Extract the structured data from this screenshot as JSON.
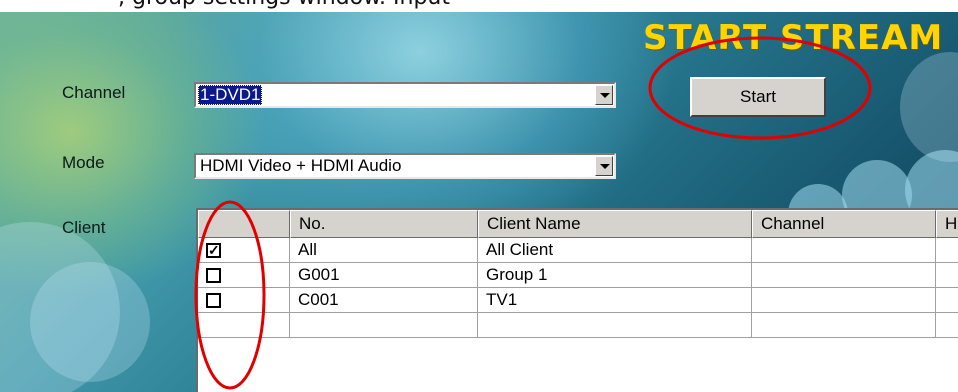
{
  "title": "START STREAM",
  "top_caption": ", group settings window. Input",
  "labels": {
    "channel": "Channel",
    "mode": "Mode",
    "client": "Client"
  },
  "channel_select": {
    "value": "1-DVD1"
  },
  "mode_select": {
    "value": "HDMI Video + HDMI Audio"
  },
  "start_button": {
    "label": "Start"
  },
  "table": {
    "columns": [
      "",
      "No.",
      "Client Name",
      "Channel",
      "H"
    ],
    "rows": [
      {
        "checked": true,
        "no": "All",
        "client_name": "All Client",
        "channel": ""
      },
      {
        "checked": false,
        "no": "G001",
        "client_name": "Group 1",
        "channel": ""
      },
      {
        "checked": false,
        "no": "C001",
        "client_name": "TV1",
        "channel": ""
      }
    ]
  },
  "colors": {
    "title": "#ffd400",
    "selection": "#0a1a8c",
    "annotation": "#e00000"
  }
}
